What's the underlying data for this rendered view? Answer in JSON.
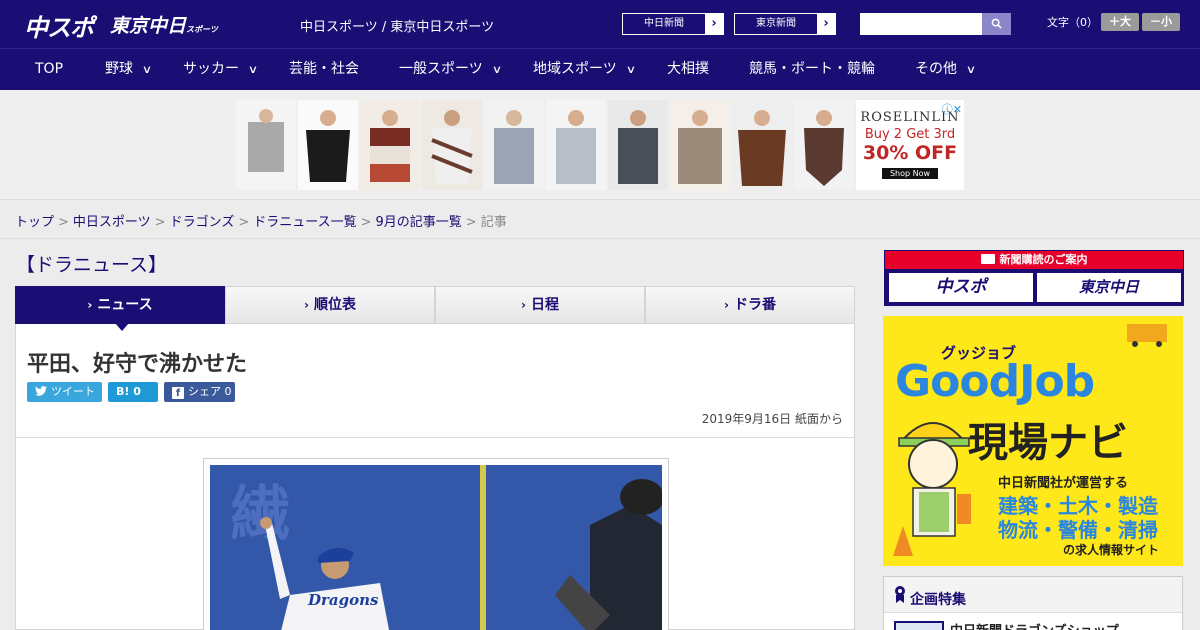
{
  "header": {
    "logo_chuspo": "中スポ",
    "logo_tokyo": "東京中日",
    "logo_tokyo_small": "スポーツ",
    "site_links": "中日スポーツ / 東京中日スポーツ",
    "paper_buttons": [
      "中日新聞",
      "東京新聞"
    ],
    "paper_arrow": "›",
    "search_placeholder": "",
    "search_icon_glyph": "🔍",
    "fontsize_label": "文字（0）",
    "font_larger": "＋大",
    "font_smaller": "－小"
  },
  "nav": {
    "items": [
      {
        "label": "TOP",
        "dropdown": false
      },
      {
        "label": "野球",
        "dropdown": true
      },
      {
        "label": "サッカー",
        "dropdown": true
      },
      {
        "label": "芸能・社会",
        "dropdown": false
      },
      {
        "label": "一般スポーツ",
        "dropdown": true
      },
      {
        "label": "地域スポーツ",
        "dropdown": true
      },
      {
        "label": "大相撲",
        "dropdown": false
      },
      {
        "label": "競馬・ボート・競輪",
        "dropdown": false
      },
      {
        "label": "その他",
        "dropdown": true
      }
    ],
    "chevron": "∨"
  },
  "ad": {
    "brand": "ROSELINLIN",
    "line1": "Buy 2 Get 3rd",
    "line2": "30% OFF",
    "cta": "Shop Now",
    "adchoice": "ⓘ✕"
  },
  "breadcrumb": {
    "links": [
      "トップ",
      "中日スポーツ",
      "ドラゴンズ",
      "ドラニュース一覧",
      "9月の記事一覧"
    ],
    "current": "記事",
    "sep": ">"
  },
  "section_title": "【ドラニュース】",
  "tabs": [
    {
      "label": "ニュース",
      "active": true
    },
    {
      "label": "順位表",
      "active": false
    },
    {
      "label": "日程",
      "active": false
    },
    {
      "label": "ドラ番",
      "active": false
    }
  ],
  "tab_chevron": "›",
  "article": {
    "headline": "平田、好守で沸かせた",
    "share_tweet": "ツイート",
    "share_hatena": "B! 0",
    "share_facebook": "シェア 0",
    "dateline": "2019年9月16日 紙面から"
  },
  "sidebar": {
    "subscribe_head": "新聞購読のご案内",
    "subscribe_logos": [
      "中スポ",
      "東京中日"
    ],
    "job_kana": "グッジョブ",
    "job_title": "GoodJob",
    "job_navi": "現場ナビ",
    "job_line1": "中日新聞社が運営する",
    "job_line2": "建築・土木・製造",
    "job_line3": "物流・警備・清掃",
    "job_line4": "の求人情報サイト",
    "feature_title": "企画特集",
    "feature_item": "中日新聞ドラゴンズショップ"
  },
  "colors": {
    "brand_navy": "#1a0d73",
    "accent_red": "#e6002a",
    "job_yellow": "#ffe81a",
    "job_blue": "#2b86e0"
  }
}
